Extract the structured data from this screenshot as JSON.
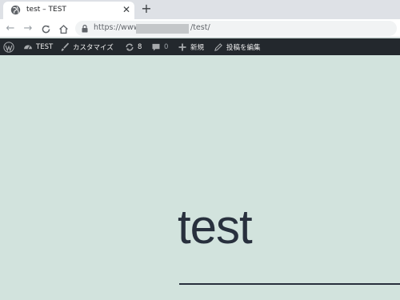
{
  "browser": {
    "tab_title": "test – TEST",
    "new_tab_label": "+",
    "url_prefix": "https://www.",
    "url_suffix": "/test/"
  },
  "admin_bar": {
    "site_name": "TEST",
    "customize": "カスタマイズ",
    "updates_count": "8",
    "comments_count": "0",
    "new_label": "新規",
    "edit_post": "投稿を編集"
  },
  "post": {
    "title": "test"
  },
  "colors": {
    "page_bg": "#d2e3dd",
    "admin_bar_bg": "#23282d",
    "title_color": "#28303d"
  }
}
